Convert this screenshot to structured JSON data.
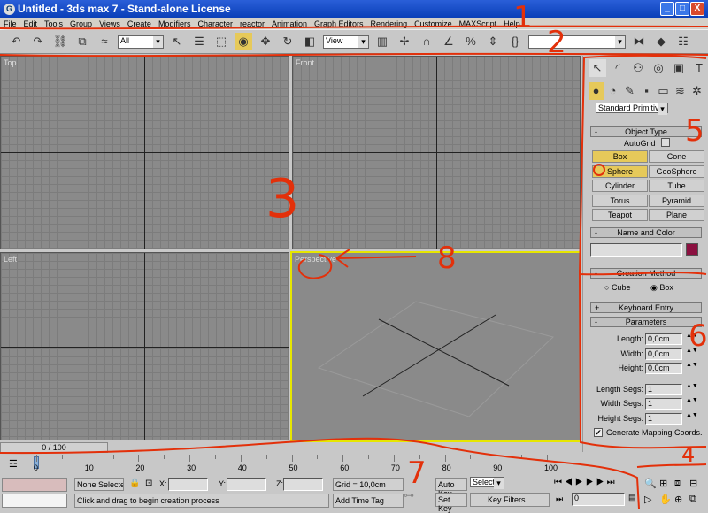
{
  "window": {
    "title": "Untitled - 3ds max 7  - Stand-alone License",
    "minimize": "_",
    "maximize": "□",
    "close": "X"
  },
  "menu": [
    "File",
    "Edit",
    "Tools",
    "Group",
    "Views",
    "Create",
    "Modifiers",
    "Character",
    "reactor",
    "Animation",
    "Graph Editors",
    "Rendering",
    "Customize",
    "MAXScript",
    "Help"
  ],
  "toolbar": {
    "selection_filter": "All",
    "ref_coord": "View",
    "named_sets": ""
  },
  "viewports": {
    "top": "Top",
    "front": "Front",
    "left": "Left",
    "perspective": "Perspective"
  },
  "command_panel": {
    "category": "Standard Primitives",
    "object_type": {
      "title": "Object Type",
      "autogrid": "AutoGrid",
      "buttons": [
        "Box",
        "Cone",
        "Sphere",
        "GeoSphere",
        "Cylinder",
        "Tube",
        "Torus",
        "Pyramid",
        "Teapot",
        "Plane"
      ],
      "active": "Box"
    },
    "name_color": {
      "title": "Name and Color",
      "name": "",
      "color": "#8b1040"
    },
    "creation_method": {
      "title": "Creation Method",
      "options": [
        "Cube",
        "Box"
      ],
      "selected": "Box"
    },
    "keyboard_entry": {
      "title": "Keyboard Entry"
    },
    "parameters": {
      "title": "Parameters",
      "fields": [
        {
          "label": "Length:",
          "value": "0,0cm"
        },
        {
          "label": "Width:",
          "value": "0,0cm"
        },
        {
          "label": "Height:",
          "value": "0,0cm"
        },
        {
          "label": "Length Segs:",
          "value": "1"
        },
        {
          "label": "Width Segs:",
          "value": "1"
        },
        {
          "label": "Height Segs:",
          "value": "1"
        }
      ],
      "mapping": "Generate Mapping Coords.",
      "mapping_checked": true
    }
  },
  "timeline": {
    "slider": "0 / 100",
    "ticks": [
      "0",
      "10",
      "20",
      "30",
      "40",
      "50",
      "60",
      "70",
      "80",
      "90",
      "100"
    ]
  },
  "status": {
    "selection": "None Selecte",
    "x_label": "X:",
    "y_label": "Y:",
    "z_label": "Z:",
    "x": "",
    "y": "",
    "z": "",
    "grid": "Grid = 10,0cm",
    "prompt": "Click and drag to begin creation process",
    "add_time_tag": "Add Time Tag",
    "auto_key": "Auto Key",
    "set_key": "Set Key",
    "key_mode": "Selected",
    "key_filters": "Key Filters...",
    "frame": "0"
  },
  "annotations": [
    "1",
    "2",
    "3",
    "4",
    "5",
    "6",
    "7",
    "8"
  ]
}
